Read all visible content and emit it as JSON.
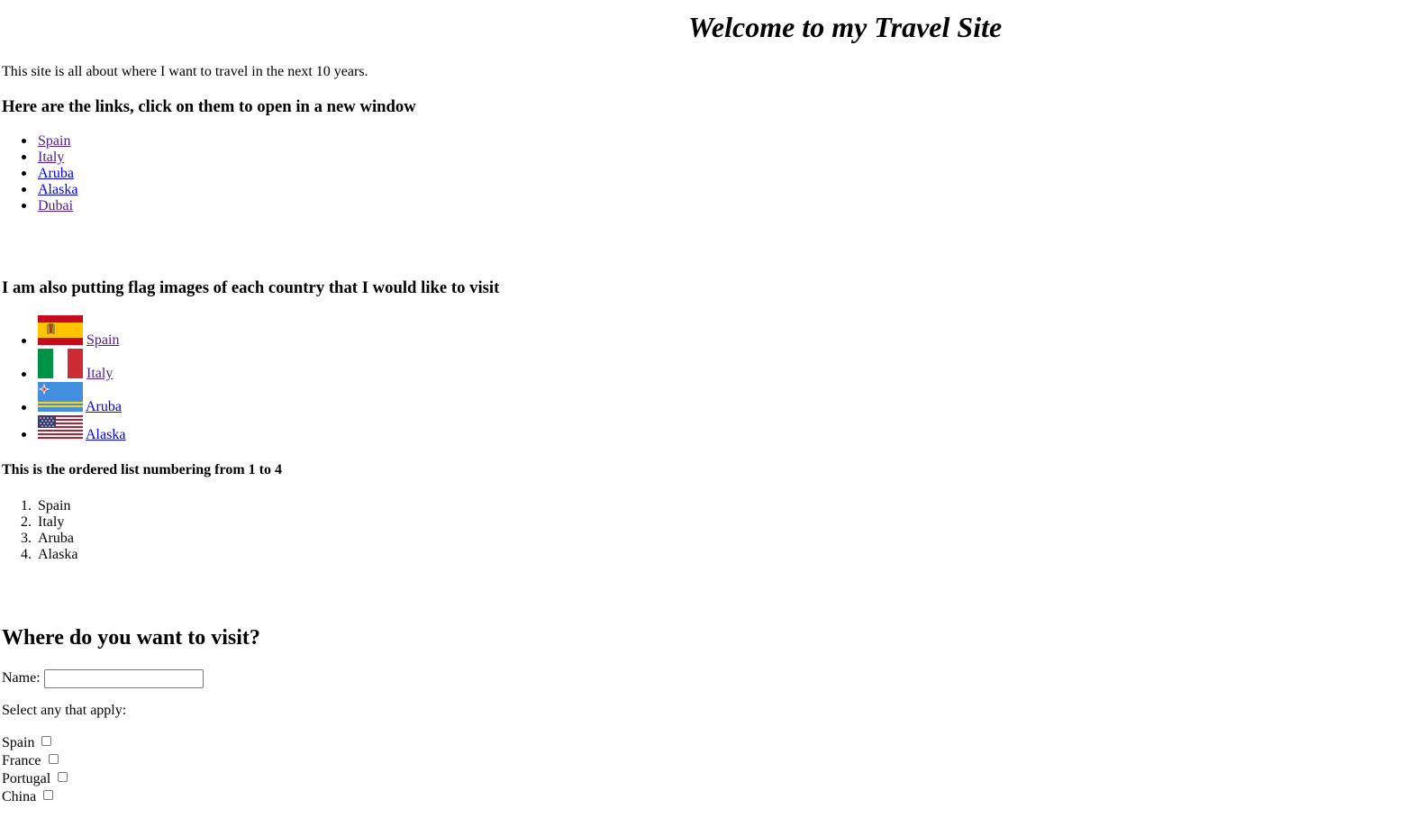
{
  "page": {
    "title": "Welcome to my Travel Site",
    "intro": "This site is all about where I want to travel in the next 10 years."
  },
  "links_section": {
    "heading": "Here are the links, click on them to open in a new window",
    "items": [
      {
        "label": "Spain",
        "visited": true
      },
      {
        "label": "Italy",
        "visited": true
      },
      {
        "label": "Aruba",
        "visited": false
      },
      {
        "label": "Alaska",
        "visited": false
      },
      {
        "label": "Dubai",
        "visited": true
      }
    ]
  },
  "flags_section": {
    "heading": "I am also putting flag images of each country that I would like to visit",
    "items": [
      {
        "label": "Spain",
        "icon": "spain-flag-icon",
        "visited": true
      },
      {
        "label": "Italy",
        "icon": "italy-flag-icon",
        "visited": true
      },
      {
        "label": "Aruba",
        "icon": "aruba-flag-icon",
        "visited": false
      },
      {
        "label": "Alaska",
        "icon": "usa-flag-icon",
        "visited": false
      }
    ]
  },
  "ordered_section": {
    "heading": "This is the ordered list numbering from 1 to 4",
    "items": [
      {
        "number": "1.",
        "label": "Spain"
      },
      {
        "number": "2.",
        "label": "Italy"
      },
      {
        "number": "3.",
        "label": "Aruba"
      },
      {
        "number": "4.",
        "label": "Alaska"
      }
    ]
  },
  "form": {
    "heading": "Where do you want to visit?",
    "name_label": "Name:",
    "name_value": "",
    "select_prompt": "Select any that apply:",
    "options": [
      {
        "label": "Spain",
        "checked": false
      },
      {
        "label": "France",
        "checked": false
      },
      {
        "label": "Portugal",
        "checked": false
      },
      {
        "label": "China",
        "checked": false
      }
    ]
  },
  "colors": {
    "link_visited": "#551a8b",
    "link_unvisited": "#0000ee"
  }
}
